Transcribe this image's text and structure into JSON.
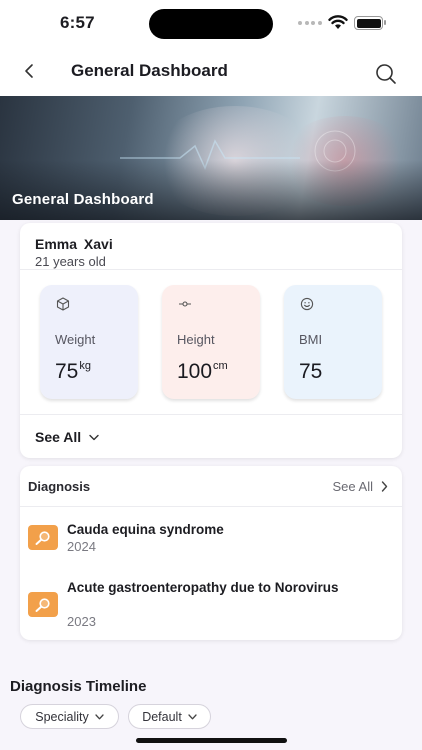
{
  "status_bar": {
    "time": "6:57"
  },
  "nav": {
    "title": "General Dashboard",
    "back_icon": "chevron-left-icon",
    "search_icon": "search-icon"
  },
  "hero": {
    "title": "General Dashboard"
  },
  "profile": {
    "name": "Emma  Xavi",
    "age": "21 years old",
    "metrics": [
      {
        "label": "Weight",
        "value": "75",
        "unit": "kg",
        "icon": "cube-icon",
        "color": "#eef0fb"
      },
      {
        "label": "Height",
        "value": "100",
        "unit": "cm",
        "icon": "ruler-icon",
        "color": "#fdeeec"
      },
      {
        "label": "BMI",
        "value": "75",
        "unit": "",
        "icon": "smiley-icon",
        "color": "#eaf3fc"
      }
    ],
    "see_all_label": "See All"
  },
  "diagnosis": {
    "header": "Diagnosis",
    "see_all_label": "See All",
    "items": [
      {
        "title": "Cauda equina syndrome",
        "year": "2024",
        "icon": "magnifier-icon"
      },
      {
        "title": "Acute gastroenteropathy due to Norovirus",
        "year": "2023",
        "icon": "magnifier-icon"
      }
    ]
  },
  "timeline": {
    "title": "Diagnosis Timeline",
    "filters": [
      {
        "label": "Speciality"
      },
      {
        "label": "Default"
      }
    ]
  },
  "colors": {
    "accent_orange": "#f2a04a",
    "page_bg": "#f7f5fb"
  }
}
